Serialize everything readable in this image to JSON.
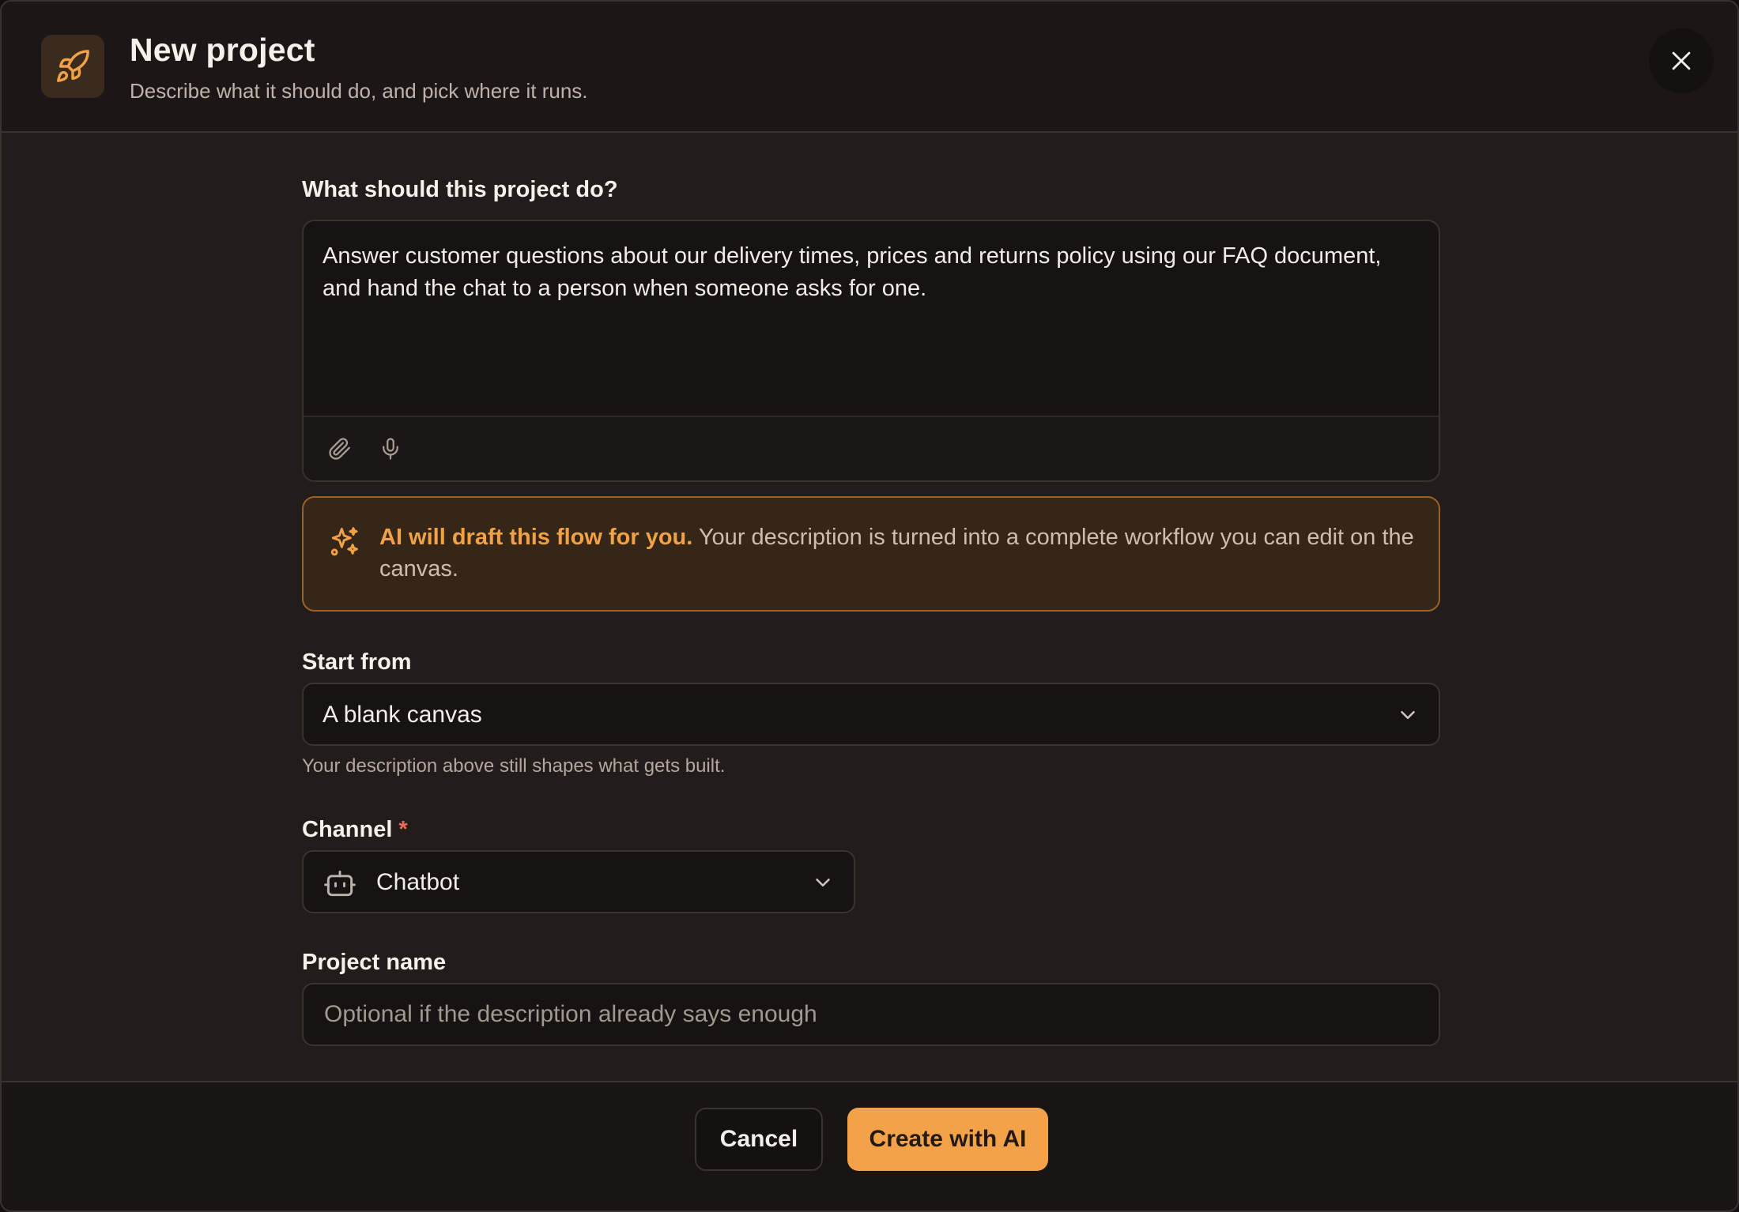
{
  "header": {
    "title": "New project",
    "subtitle": "Describe what it should do, and pick where it runs.",
    "icon": "rocket-icon",
    "close_icon": "close-icon"
  },
  "description": {
    "label": "What should this project do?",
    "value": "Answer customer questions about our delivery times, prices and returns policy using our FAQ document, and hand the chat to a person when someone asks for one.",
    "tools": [
      "paperclip-icon",
      "microphone-icon"
    ]
  },
  "ai_callout": {
    "icon": "sparkles-icon",
    "strong": "AI will draft this flow for you.",
    "text": " Your description is turned into a complete workflow you can edit on the canvas."
  },
  "start_from": {
    "label": "Start from",
    "value": "A blank canvas",
    "help": "Your description above still shapes what gets built."
  },
  "channel": {
    "label": "Channel",
    "required_mark": "*",
    "value": "Chatbot",
    "icon": "robot-icon"
  },
  "project_name": {
    "label": "Project name",
    "placeholder": "Optional if the description already says enough",
    "value": ""
  },
  "footer": {
    "cancel_label": "Cancel",
    "create_label": "Create with AI"
  },
  "colors": {
    "accent": "#f3a24a",
    "background": "#221c1a",
    "required": "#ee6a55"
  }
}
